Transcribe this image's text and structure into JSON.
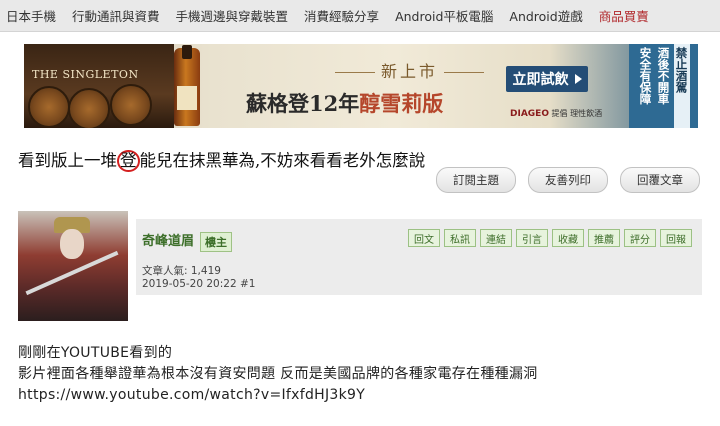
{
  "topnav": {
    "items": [
      {
        "label": "日本手機"
      },
      {
        "label": "行動通訊與資費"
      },
      {
        "label": "手機週邊與穿戴裝置"
      },
      {
        "label": "消費經驗分享"
      },
      {
        "label": "Android平板電腦"
      },
      {
        "label": "Android遊戲"
      },
      {
        "label": "商品買賣"
      }
    ],
    "active_color": "#b0262a"
  },
  "banner": {
    "brand": "THE SINGLETON",
    "tagline": "新上市",
    "headline_prefix": "蘇格登12年",
    "headline_accent": "醇雪莉版",
    "cta": "立即試飲",
    "diageo_brand": "DIAGEO",
    "diageo_text": "提倡 理性飲酒",
    "warning_col1": "禁止酒駕",
    "warning_col2": "酒後不開車",
    "warning_col3": "安全有保障"
  },
  "thread": {
    "title_before": "看到版上一堆",
    "title_circled": "登",
    "title_after": "能兒在抹黑華為,不妨來看看老外怎麼說",
    "actions": [
      {
        "label": "訂閱主題"
      },
      {
        "label": "友善列印"
      },
      {
        "label": "回覆文章"
      }
    ]
  },
  "post": {
    "author": "奇峰道眉",
    "owner_tag": "樓主",
    "post_count": "文章人氣: 1,419",
    "timestamp": "2019-05-20 20:22",
    "floor": "#1",
    "actions": [
      {
        "label": "回文"
      },
      {
        "label": "私訊"
      },
      {
        "label": "連結"
      },
      {
        "label": "引言"
      },
      {
        "label": "收藏"
      },
      {
        "label": "推薦"
      },
      {
        "label": "評分"
      },
      {
        "label": "回報"
      }
    ],
    "body_lines": [
      "剛剛在YOUTUBE看到的",
      "影片裡面各種舉證華為根本沒有資安問題 反而是美國品牌的各種家電存在種種漏洞",
      "https://www.youtube.com/watch?v=IfxfdHJ3k9Y"
    ]
  },
  "colors": {
    "green_accent": "#3d6f2a",
    "circle_red": "#d42020"
  }
}
